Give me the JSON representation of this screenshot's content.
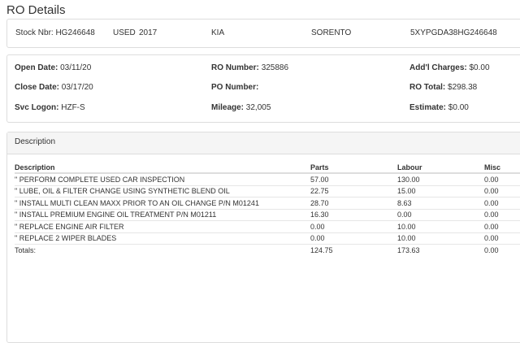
{
  "page": {
    "title": "RO Details"
  },
  "vehicle": {
    "stock_nbr": "Stock Nbr: HG246648",
    "condition": "USED",
    "year": "2017",
    "make": "KIA",
    "model": "SORENTO",
    "vin": "5XYPGDA38HG246648"
  },
  "ro": {
    "open_date_label": "Open Date:",
    "open_date": "03/11/20",
    "close_date_label": "Close Date:",
    "close_date": "03/17/20",
    "svc_logon_label": "Svc Logon:",
    "svc_logon": "HZF-S",
    "ro_number_label": "RO Number:",
    "ro_number": "325886",
    "po_number_label": "PO Number:",
    "po_number": "",
    "mileage_label": "Mileage:",
    "mileage": "32,005",
    "addl_charges_label": "Add'l Charges:",
    "addl_charges": "$0.00",
    "ro_total_label": "RO Total:",
    "ro_total": "$298.38",
    "estimate_label": "Estimate:",
    "estimate": "$0.00"
  },
  "description_panel": {
    "heading": "Description",
    "columns": [
      "Description",
      "Parts",
      "Labour",
      "Misc"
    ],
    "rows": [
      {
        "description": "\" PERFORM COMPLETE USED CAR INSPECTION",
        "parts": "57.00",
        "labour": "130.00",
        "misc": "0.00"
      },
      {
        "description": "\" LUBE, OIL & FILTER CHANGE USING SYNTHETIC BLEND OIL",
        "parts": "22.75",
        "labour": "15.00",
        "misc": "0.00"
      },
      {
        "description": "\" INSTALL MULTI CLEAN MAXX PRIOR TO AN OIL CHANGE P/N M01241",
        "parts": "28.70",
        "labour": "8.63",
        "misc": "0.00"
      },
      {
        "description": "\" INSTALL PREMIUM ENGINE OIL TREATMENT P/N M01211",
        "parts": "16.30",
        "labour": "0.00",
        "misc": "0.00"
      },
      {
        "description": "\" REPLACE ENGINE AIR FILTER",
        "parts": "0.00",
        "labour": "10.00",
        "misc": "0.00"
      },
      {
        "description": "\" REPLACE 2 WIPER BLADES",
        "parts": "0.00",
        "labour": "10.00",
        "misc": "0.00"
      }
    ],
    "totals": {
      "label": "Totals:",
      "parts": "124.75",
      "labour": "173.63",
      "misc": "0.00"
    }
  }
}
